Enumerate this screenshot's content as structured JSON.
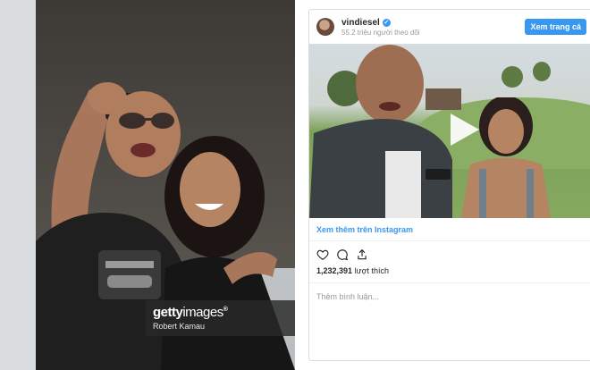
{
  "photo": {
    "watermark_brand_bold": "getty",
    "watermark_brand_regular": "images",
    "watermark_trademark": "®",
    "credit": "Robert Kamau"
  },
  "instagram": {
    "username": "vindiesel",
    "followers_text": "55.2 triệu người theo dõi",
    "profile_button": "Xem trang cá",
    "see_more_link": "Xem thêm trên Instagram",
    "likes_count": "1,232,391",
    "likes_label": "lượt thích",
    "comment_placeholder": "Thêm bình luận...",
    "accent_color": "#3897f0"
  }
}
